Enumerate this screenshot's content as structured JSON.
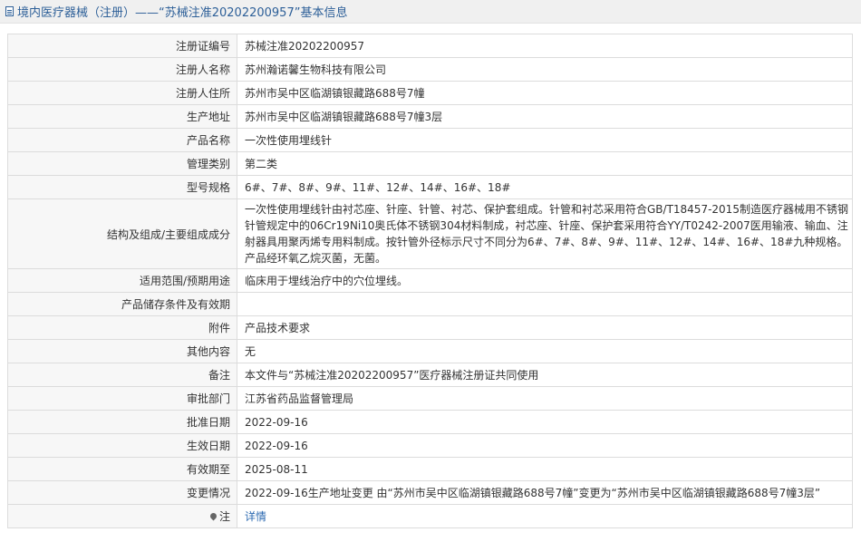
{
  "header": {
    "title": "境内医疗器械（注册）——“苏械注准20202200957”基本信息"
  },
  "rows": [
    {
      "label": "注册证编号",
      "value": "苏械注准20202200957"
    },
    {
      "label": "注册人名称",
      "value": "苏州瀚诺馨生物科技有限公司"
    },
    {
      "label": "注册人住所",
      "value": "苏州市吴中区临湖镇银藏路688号7幢"
    },
    {
      "label": "生产地址",
      "value": "苏州市吴中区临湖镇银藏路688号7幢3层"
    },
    {
      "label": "产品名称",
      "value": "一次性使用埋线针"
    },
    {
      "label": "管理类别",
      "value": "第二类"
    },
    {
      "label": "型号规格",
      "value": "6#、7#、8#、9#、11#、12#、14#、16#、18#"
    },
    {
      "label": "结构及组成/主要组成成分",
      "value": "一次性使用埋线针由衬芯座、针座、针管、衬芯、保护套组成。针管和衬芯采用符合GB/T18457-2015制造医疗器械用不锈钢针管规定中的06Cr19Ni10奥氏体不锈钢304材料制成，衬芯座、针座、保护套采用符合YY/T0242-2007医用输液、输血、注射器具用聚丙烯专用料制成。按针管外径标示尺寸不同分为6#、7#、8#、9#、11#、12#、14#、16#、18#九种规格。产品经环氧乙烷灭菌，无菌。"
    },
    {
      "label": "适用范围/预期用途",
      "value": "临床用于埋线治疗中的穴位埋线。"
    },
    {
      "label": "产品储存条件及有效期",
      "value": ""
    },
    {
      "label": "附件",
      "value": "产品技术要求"
    },
    {
      "label": "其他内容",
      "value": "无"
    },
    {
      "label": "备注",
      "value": "本文件与“苏械注准20202200957”医疗器械注册证共同使用"
    },
    {
      "label": "审批部门",
      "value": "江苏省药品监督管理局"
    },
    {
      "label": "批准日期",
      "value": "2022-09-16"
    },
    {
      "label": "生效日期",
      "value": "2022-09-16"
    },
    {
      "label": "有效期至",
      "value": "2025-08-11"
    },
    {
      "label": "变更情况",
      "value": "2022-09-16生产地址变更 由“苏州市吴中区临湖镇银藏路688号7幢”变更为“苏州市吴中区临湖镇银藏路688号7幢3层”"
    }
  ],
  "note": {
    "label": "注",
    "link": "详情",
    "icon": "pin-icon"
  }
}
